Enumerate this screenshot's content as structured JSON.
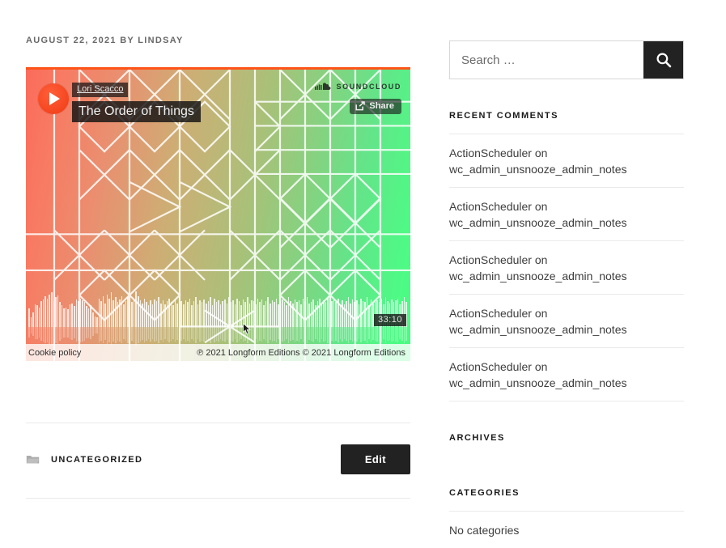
{
  "post": {
    "meta_date": "AUGUST 22, 2021",
    "meta_by": "BY",
    "meta_author": "LINDSAY"
  },
  "player": {
    "artist": "Lori Scacco",
    "track": "The Order of Things",
    "brand": "SOUNDCLOUD",
    "share_label": "Share",
    "duration": "33:10",
    "cookie_policy": "Cookie policy",
    "copyright": "℗ 2021 Longform Editions © 2021 Longform Editions",
    "play_icon": "play-icon",
    "colors": {
      "gradient_start": "#fb6b5b",
      "gradient_mid": "#bdb777",
      "gradient_end": "#46fd80",
      "top_border": "#ff5419",
      "play_button": "#f4451f"
    },
    "waveform": [
      38,
      20,
      30,
      46,
      44,
      40,
      52,
      56,
      62,
      58,
      66,
      70,
      52,
      60,
      64,
      50,
      44,
      38,
      40,
      36,
      46,
      48,
      42,
      56,
      52,
      58,
      54,
      50,
      42,
      38,
      44,
      30,
      22,
      20,
      58,
      52,
      62,
      48,
      66,
      58,
      70,
      54,
      60,
      50,
      56,
      62,
      46,
      52,
      60,
      44,
      50,
      58,
      72,
      62,
      54,
      48,
      58,
      50,
      44,
      54,
      46,
      56,
      52,
      60,
      48,
      54,
      46,
      52,
      58,
      50,
      44,
      56,
      48,
      60,
      52,
      46,
      54,
      50,
      58,
      44,
      52,
      60,
      46,
      54,
      50,
      56,
      48,
      52,
      60,
      44,
      58,
      50,
      54,
      46,
      52,
      56,
      48,
      60,
      50,
      54,
      46,
      58,
      52,
      44,
      56,
      50,
      60,
      48,
      54,
      52,
      46,
      58,
      50,
      56,
      44,
      52,
      60,
      48,
      54,
      50,
      58,
      46,
      52,
      56,
      50,
      44,
      60,
      52,
      48,
      56,
      50,
      54,
      46,
      58,
      52,
      60,
      48,
      50,
      56,
      44,
      52,
      58,
      46,
      54,
      50,
      60,
      48,
      52,
      56,
      50,
      58,
      44,
      54,
      46,
      52,
      60,
      48,
      56,
      50,
      54,
      46,
      58,
      52,
      50,
      60,
      44,
      56,
      48,
      52,
      54,
      50,
      58,
      46,
      60,
      52,
      48,
      56,
      50,
      54,
      58,
      46,
      52,
      60,
      50
    ]
  },
  "entry_footer": {
    "category_icon": "folder-icon",
    "category_label": "UNCATEGORIZED",
    "edit_label": "Edit"
  },
  "sidebar": {
    "search": {
      "placeholder": "Search …",
      "value": "",
      "submit_icon": "search-icon"
    },
    "recent_comments": {
      "title": "Recent Comments",
      "items": [
        {
          "author": "ActionScheduler",
          "on": "on",
          "post": "wc_admin_unsnooze_admin_notes"
        },
        {
          "author": "ActionScheduler",
          "on": "on",
          "post": "wc_admin_unsnooze_admin_notes"
        },
        {
          "author": "ActionScheduler",
          "on": "on",
          "post": "wc_admin_unsnooze_admin_notes"
        },
        {
          "author": "ActionScheduler",
          "on": "on",
          "post": "wc_admin_unsnooze_admin_notes"
        },
        {
          "author": "ActionScheduler",
          "on": "on",
          "post": "wc_admin_unsnooze_admin_notes"
        }
      ]
    },
    "archives": {
      "title": "Archives",
      "items": []
    },
    "categories": {
      "title": "Categories",
      "empty_label": "No categories"
    }
  }
}
